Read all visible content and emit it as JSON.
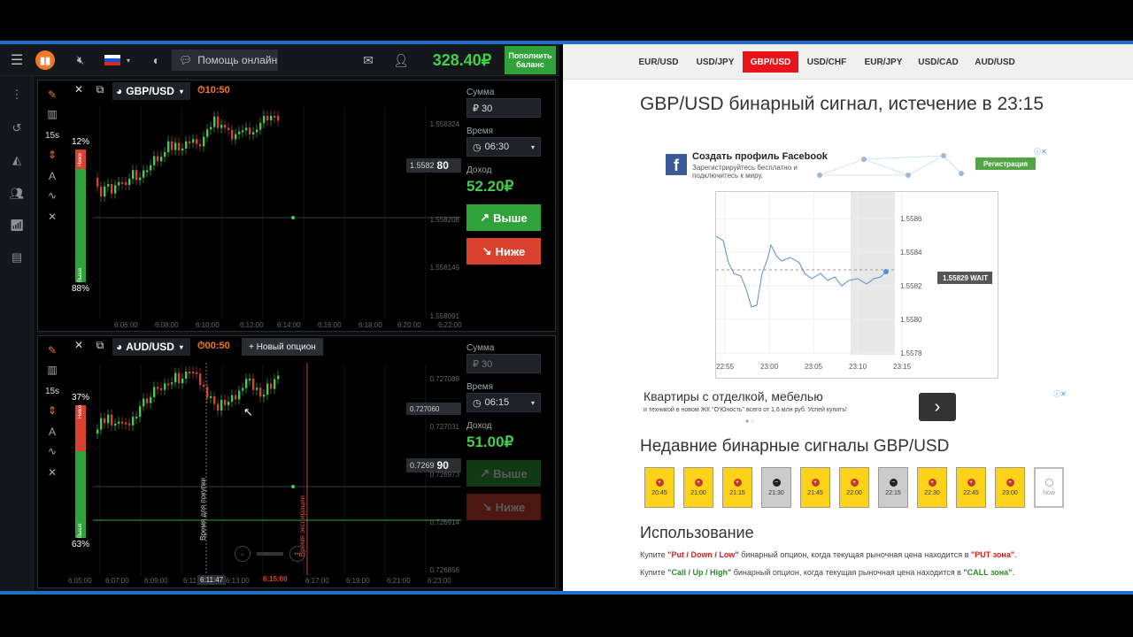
{
  "header": {
    "help_label": "Помощь онлайн",
    "balance": "328.40₽",
    "deposit_label": "Пополнить баланс"
  },
  "panel1": {
    "asset": "GBP/USD",
    "timer": "10:50",
    "sum_label": "Сумма",
    "sum_value": "₽  30",
    "time_label": "Время",
    "time_value": "06:30",
    "profit_label": "Доход",
    "profit_value": "52.20₽",
    "up_label": "Выше",
    "down_label": "Ниже",
    "pct_top": "12%",
    "pct_bottom": "88%",
    "bar_top_label": "Ниже",
    "bar_bottom_label": "Выше",
    "interval": "15s",
    "price_tag": "1.5582",
    "price_tag_big": "80",
    "y_ticks": [
      "1.558324",
      "1.558208",
      "1.558149",
      "1.558091"
    ],
    "x_ticks": [
      "6:06:00",
      "6:08:00",
      "6:10:00",
      "6:12:00",
      "6:14:00",
      "6:16:00",
      "6:18:00",
      "6:20:00",
      "6:22:00"
    ]
  },
  "panel2": {
    "asset": "AUD/USD",
    "timer": "00:50",
    "new_option_label": "+ Новый опцион",
    "sum_label": "Сумма",
    "sum_value": "₽  30",
    "time_label": "Время",
    "time_value": "06:15",
    "profit_label": "Доход",
    "profit_value": "51.00₽",
    "up_label": "Выше",
    "down_label": "Ниже",
    "pct_top": "37%",
    "pct_bottom": "63%",
    "bar_top_label": "Ниже",
    "bar_bottom_label": "Выше",
    "interval": "15s",
    "price_tag": "0.7269",
    "price_tag_big": "90",
    "price_tag2": "0.727060",
    "purchase_time_label": "Время для покупки",
    "expiry_label": "Время экспирации",
    "cursor_time": "6:11:47",
    "expiry_time": "6:15:00",
    "y_ticks": [
      "0.727089",
      "0.727031",
      "0.726973",
      "0.726914",
      "0.726856"
    ],
    "x_ticks": [
      "6:05:00",
      "6:07:00",
      "6:09:00",
      "6:11",
      "6:13:00",
      "6:17:00",
      "6:19:00",
      "6:21:00",
      "6:23:00"
    ]
  },
  "web": {
    "tabs": [
      "EUR/USD",
      "USD/JPY",
      "GBP/USD",
      "USD/CHF",
      "EUR/JPY",
      "USD/CAD",
      "AUD/USD"
    ],
    "active_tab": "GBP/USD",
    "title": "GBP/USD бинарный сигнал, истечение в 23:15",
    "fb_title": "Создать профиль Facebook",
    "fb_sub": "Зарегистрируйтесь бесплатно и подключитесь к миру.",
    "fb_btn": "Регистрация",
    "chart_wait": "1.55829 WAIT",
    "chart_y": [
      "1.5586",
      "1.5584",
      "1.5582",
      "1.5580",
      "1.5578"
    ],
    "chart_x": [
      "22:55",
      "23:00",
      "23:05",
      "23:10",
      "23:15"
    ],
    "ad2_title": "Квартиры с отделкой, мебелью",
    "ad2_sub": "и техникой в новом ЖК \"О'Юность\" всего от 1,6 млн руб. Успей купить!",
    "recent_title": "Недавние бинарные сигналы GBP/USD",
    "signals": [
      {
        "time": "20:45",
        "kind": "y"
      },
      {
        "time": "21:00",
        "kind": "y"
      },
      {
        "time": "21:15",
        "kind": "y"
      },
      {
        "time": "21:30",
        "kind": "g"
      },
      {
        "time": "21:45",
        "kind": "y"
      },
      {
        "time": "22:00",
        "kind": "y"
      },
      {
        "time": "22:15",
        "kind": "g"
      },
      {
        "time": "22:30",
        "kind": "y"
      },
      {
        "time": "22:45",
        "kind": "y"
      },
      {
        "time": "23:00",
        "kind": "y"
      },
      {
        "time": "Now",
        "kind": "w"
      }
    ],
    "usage_title": "Использование",
    "usage1_a": "Купите ",
    "usage1_b": "\"Put / Down / Low\"",
    "usage1_c": " бинарный опцион, когда текущая рыночная цена находится в ",
    "usage1_d": "\"PUT зона\"",
    "usage2_a": "Купите ",
    "usage2_b": "\"Call / Up / High\"",
    "usage2_c": " бинарный опцион, когда текущая рыночная цена находится в ",
    "usage2_d": "\"CALL зона\""
  },
  "colors": {
    "accent_red": "#e8141c",
    "up_green": "#2fa33a",
    "down_red": "#d9422f",
    "balance_green": "#3fcf4a"
  }
}
